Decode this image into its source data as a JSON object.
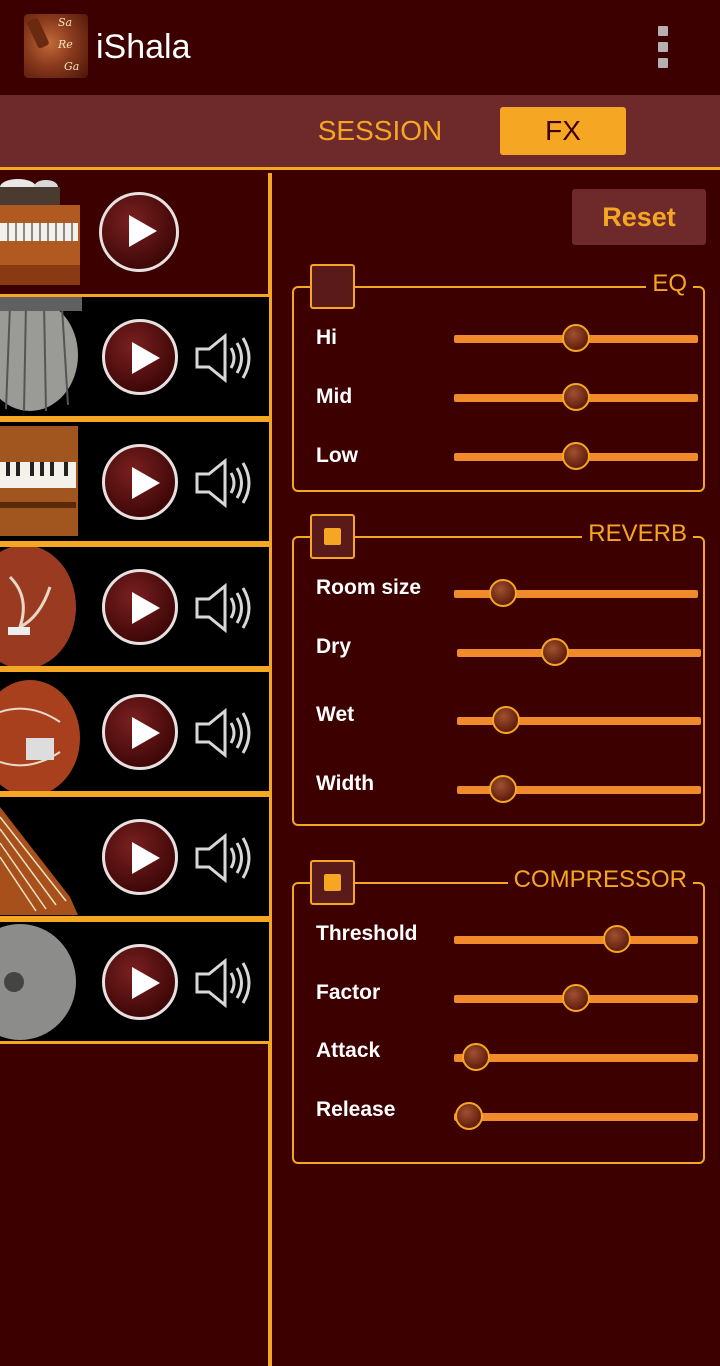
{
  "app": {
    "title": "iShala",
    "logo_text": [
      "Sa",
      "Re",
      "Ga"
    ]
  },
  "tabs": [
    {
      "label": "SESSION",
      "selected": false
    },
    {
      "label": "FX",
      "selected": true
    }
  ],
  "colors": {
    "background": "#3d0000",
    "accent": "#f5a623",
    "tab_bar": "#6e2a2a"
  },
  "instruments": [
    {
      "name_icon": "tabla-harmonium-icon",
      "has_volume": false
    },
    {
      "name_icon": "tabla-icon",
      "has_volume": true
    },
    {
      "name_icon": "harmonium-icon",
      "has_volume": true
    },
    {
      "name_icon": "tanpura-icon",
      "has_volume": true
    },
    {
      "name_icon": "sitar-icon",
      "has_volume": true
    },
    {
      "name_icon": "swarmandal-icon",
      "has_volume": true
    },
    {
      "name_icon": "manjira-icon",
      "has_volume": true
    }
  ],
  "fx": {
    "reset_label": "Reset",
    "eq": {
      "title": "EQ",
      "enabled": false,
      "sliders": [
        {
          "label": "Hi",
          "value": 0.5
        },
        {
          "label": "Mid",
          "value": 0.5
        },
        {
          "label": "Low",
          "value": 0.5
        }
      ]
    },
    "reverb": {
      "title": "REVERB",
      "enabled": true,
      "sliders": [
        {
          "label": "Room size",
          "value": 0.2
        },
        {
          "label": "Dry",
          "value": 0.4
        },
        {
          "label": "Wet",
          "value": 0.2
        },
        {
          "label": "Width",
          "value": 0.19
        }
      ]
    },
    "compressor": {
      "title": "COMPRESSOR",
      "enabled": true,
      "sliders": [
        {
          "label": "Threshold",
          "value": 0.67
        },
        {
          "label": "Factor",
          "value": 0.5
        },
        {
          "label": "Attack",
          "value": 0.09
        },
        {
          "label": "Release",
          "value": 0.06
        }
      ]
    }
  }
}
